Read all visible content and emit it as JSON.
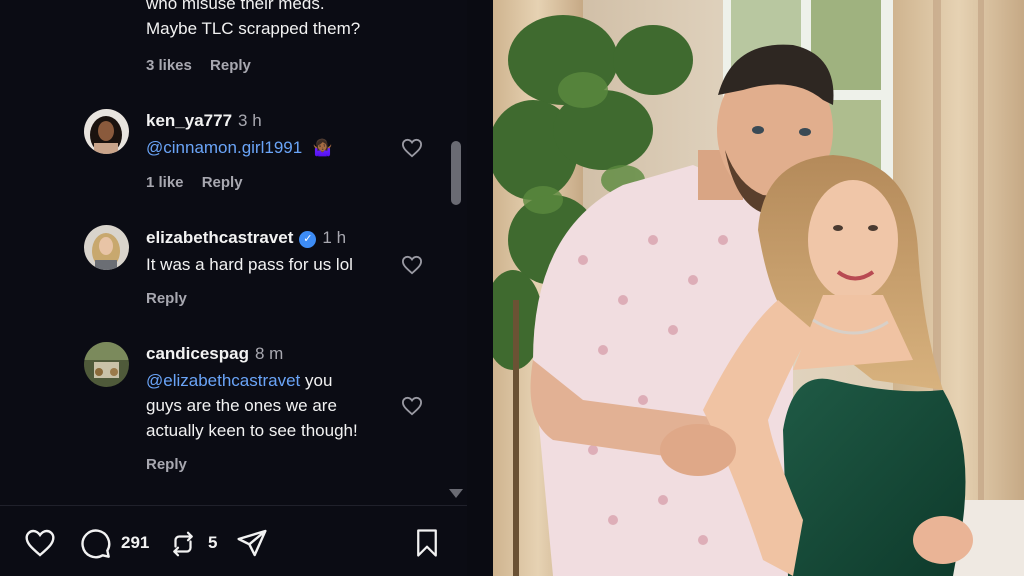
{
  "comments": [
    {
      "text_lines": [
        "who misuse their meds.",
        "Maybe TLC scrapped them?"
      ],
      "likes": "3 likes",
      "reply": "Reply"
    },
    {
      "username": "ken_ya777",
      "time": "3 h",
      "mention": "@cinnamon.girl1991",
      "emoji": "🤷🏾‍♀️",
      "likes": "1 like",
      "reply": "Reply"
    },
    {
      "username": "elizabethcastravet",
      "verified": true,
      "time": "1 h",
      "text": "It was a hard pass for us lol",
      "reply": "Reply"
    },
    {
      "username": "candicespag",
      "time": "8 m",
      "mention": "@elizabethcastravet",
      "text_first": "you",
      "text_lines": [
        "guys are the ones we are",
        "actually keen to see though!"
      ],
      "reply": "Reply"
    }
  ],
  "actions": {
    "comment_count": "291",
    "repost_count": "5"
  },
  "colors": {
    "background": "#0b0c14",
    "mention": "#6aa4f7",
    "verified": "#3d8cf5",
    "muted": "#a8a8b0"
  },
  "icons": [
    "heart-icon",
    "comment-icon",
    "repost-icon",
    "share-icon",
    "bookmark-icon",
    "verified-icon"
  ]
}
